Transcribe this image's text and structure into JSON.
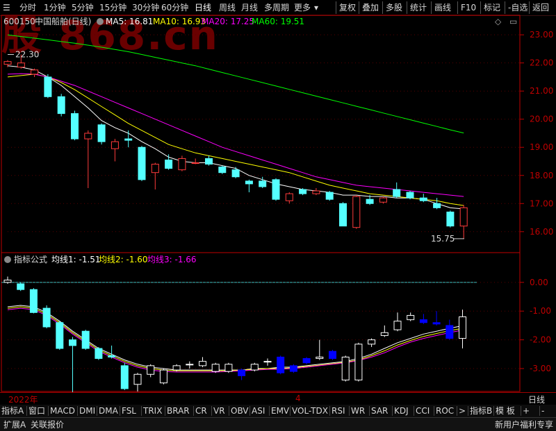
{
  "toolbar": {
    "left_items": [
      "分时",
      "1分钟",
      "5分钟",
      "15分钟",
      "30分钟",
      "60分钟",
      "日线",
      "周线",
      "月线",
      "多周期",
      "更多"
    ],
    "active_item": "日线",
    "right_items": [
      "复权",
      "叠加",
      "多股",
      "统计",
      "画线",
      "F10",
      "标记",
      "-自选",
      "返回"
    ]
  },
  "watermark": "股 868.cn",
  "stock": {
    "code": "600150",
    "name": "中国船舶",
    "period": "(日线)"
  },
  "ma": [
    {
      "label": "MA5: 16.81",
      "color": "#ffffff"
    },
    {
      "label": "MA10: 16.93",
      "color": "#ffff00"
    },
    {
      "label": "MA20: 17.25",
      "color": "#ff00ff"
    },
    {
      "label": "MA60: 19.51",
      "color": "#00ff00"
    }
  ],
  "price_axis": [
    "23.00",
    "22.00",
    "21.00",
    "20.00",
    "19.00",
    "18.00",
    "17.00",
    "16.00"
  ],
  "max_label": "22.30",
  "min_label": "15.75",
  "indicator": {
    "title": "指标公式",
    "lines": [
      {
        "label": "均线1: -1.51",
        "color": "#ffffff"
      },
      {
        "label": "均线2: -1.60",
        "color": "#ffff00"
      },
      {
        "label": "均线3: -1.66",
        "color": "#ff00ff"
      }
    ],
    "axis": [
      "0.00",
      "-1.00",
      "-2.00",
      "-3.00"
    ]
  },
  "time_axis": {
    "start": "2022年",
    "mid": "4",
    "period": "日线"
  },
  "tabs": [
    "指标A",
    "窗口",
    "MACD",
    "DMI",
    "DMA",
    "FSL",
    "TRIX",
    "BRAR",
    "CR",
    "VR",
    "OBV",
    "ASI",
    "EMV",
    "VOL-TDX",
    "RSI",
    "WR",
    "SAR",
    "KDJ",
    "CCI",
    "ROC",
    ">",
    "指标B",
    "模 板",
    "+",
    "-"
  ],
  "status": {
    "left": [
      "扩展A",
      "关联报价"
    ],
    "right": "新用户福利专享"
  },
  "chart_data": [
    {
      "type": "candlestick",
      "title": "600150 中国船舶(日线)",
      "ylim": [
        15.6,
        23.3
      ],
      "candles": [
        [
          21.95,
          22.05,
          21.85,
          22.1
        ],
        [
          21.85,
          22.0,
          21.8,
          22.3
        ],
        [
          21.6,
          21.75,
          21.5,
          21.8
        ],
        [
          21.5,
          20.8,
          20.75,
          21.6
        ],
        [
          20.8,
          20.2,
          20.1,
          20.9
        ],
        [
          20.2,
          19.3,
          19.25,
          20.3
        ],
        [
          19.3,
          19.5,
          17.55,
          19.6
        ],
        [
          19.8,
          19.2,
          19.1,
          19.85
        ],
        [
          18.95,
          19.2,
          18.5,
          19.3
        ],
        [
          19.3,
          19.25,
          19.0,
          19.6
        ],
        [
          19.0,
          17.85,
          17.8,
          19.05
        ],
        [
          18.1,
          18.4,
          17.5,
          18.45
        ],
        [
          18.55,
          18.25,
          18.2,
          18.75
        ],
        [
          18.2,
          18.6,
          18.15,
          18.7
        ],
        [
          18.45,
          18.45,
          18.4,
          18.6
        ],
        [
          18.6,
          18.4,
          18.35,
          18.7
        ],
        [
          18.3,
          18.1,
          18.05,
          18.35
        ],
        [
          18.2,
          17.95,
          17.9,
          18.3
        ],
        [
          17.8,
          17.7,
          17.4,
          17.85
        ],
        [
          17.8,
          17.6,
          17.55,
          17.95
        ],
        [
          17.85,
          17.15,
          17.1,
          17.9
        ],
        [
          17.1,
          17.35,
          17.0,
          17.4
        ],
        [
          17.5,
          17.35,
          17.3,
          17.55
        ],
        [
          17.35,
          17.45,
          17.3,
          17.55
        ],
        [
          17.4,
          17.15,
          17.1,
          17.45
        ],
        [
          17.0,
          16.2,
          16.2,
          17.05
        ],
        [
          16.15,
          17.25,
          16.1,
          17.3
        ],
        [
          17.15,
          17.0,
          16.95,
          17.3
        ],
        [
          17.05,
          17.2,
          17.0,
          17.25
        ],
        [
          17.5,
          17.25,
          17.2,
          17.75
        ],
        [
          17.4,
          17.2,
          17.15,
          17.45
        ],
        [
          17.2,
          17.1,
          17.05,
          17.35
        ],
        [
          17.0,
          16.85,
          16.8,
          17.2
        ],
        [
          16.7,
          16.2,
          16.15,
          16.75
        ],
        [
          16.2,
          16.85,
          15.75,
          16.95
        ]
      ],
      "series": [
        {
          "name": "MA5",
          "values": [
            21.9,
            21.85,
            21.75,
            21.5,
            21.2,
            20.8,
            20.4,
            19.95,
            19.7,
            19.5,
            19.2,
            18.95,
            18.65,
            18.5,
            18.45,
            18.45,
            18.35,
            18.25,
            18.0,
            17.85,
            17.7,
            17.6,
            17.5,
            17.45,
            17.4,
            17.3,
            17.3,
            17.25,
            17.25,
            17.2,
            17.2,
            17.15,
            17.0,
            16.85,
            16.81
          ]
        },
        {
          "name": "MA10",
          "values": [
            21.5,
            21.55,
            21.6,
            21.5,
            21.3,
            21.05,
            20.75,
            20.45,
            20.15,
            19.85,
            19.6,
            19.35,
            19.1,
            18.95,
            18.8,
            18.7,
            18.6,
            18.5,
            18.4,
            18.3,
            18.2,
            18.1,
            17.95,
            17.8,
            17.65,
            17.55,
            17.45,
            17.35,
            17.3,
            17.25,
            17.2,
            17.15,
            17.1,
            17.0,
            16.93
          ]
        },
        {
          "name": "MA20",
          "values": [
            21.6,
            21.62,
            21.6,
            21.5,
            21.35,
            21.2,
            21.0,
            20.8,
            20.6,
            20.4,
            20.2,
            20.0,
            19.8,
            19.6,
            19.4,
            19.2,
            19.0,
            18.85,
            18.7,
            18.55,
            18.4,
            18.25,
            18.1,
            17.95,
            17.85,
            17.75,
            17.65,
            17.6,
            17.55,
            17.5,
            17.45,
            17.4,
            17.35,
            17.3,
            17.25
          ]
        },
        {
          "name": "MA60",
          "values": [
            23.0,
            22.94,
            22.88,
            22.82,
            22.76,
            22.7,
            22.63,
            22.56,
            22.48,
            22.4,
            22.3,
            22.2,
            22.1,
            22.0,
            21.9,
            21.78,
            21.66,
            21.54,
            21.42,
            21.3,
            21.18,
            21.06,
            20.94,
            20.82,
            20.7,
            20.58,
            20.46,
            20.34,
            20.22,
            20.1,
            19.98,
            19.86,
            19.74,
            19.62,
            19.51
          ]
        }
      ]
    },
    {
      "type": "candlestick",
      "title": "指标公式",
      "ylim": [
        -3.7,
        0.6
      ],
      "candles": [
        [
          0.0,
          0.08,
          -0.05,
          0.2
        ],
        [
          -0.05,
          -0.25,
          -0.3,
          0.0
        ],
        [
          -0.25,
          -1.05,
          -1.08,
          -0.2
        ],
        [
          -0.9,
          -1.55,
          -1.6,
          -0.8
        ],
        [
          -1.4,
          -2.3,
          -2.35,
          -1.35
        ],
        [
          -2.0,
          -2.2,
          -3.9,
          -1.9
        ],
        [
          -1.7,
          -2.3,
          -2.35,
          -1.65
        ],
        [
          -2.3,
          -2.65,
          -2.7,
          -2.25
        ],
        [
          -2.55,
          -2.6,
          -2.65,
          -2.2
        ],
        [
          -2.9,
          -3.7,
          -3.75,
          -2.8
        ],
        [
          -3.55,
          -3.2,
          -3.8,
          -3.15
        ],
        [
          -3.2,
          -2.9,
          -3.3,
          -2.85
        ],
        [
          -3.5,
          -3.05,
          -3.55,
          -3.0
        ],
        [
          -3.05,
          -2.9,
          -3.1,
          -2.85
        ],
        [
          -2.85,
          -2.85,
          -3.0,
          -2.75
        ],
        [
          -2.9,
          -2.75,
          -2.95,
          -2.6
        ],
        [
          -3.1,
          -2.85,
          -3.15,
          -2.8
        ],
        [
          -3.1,
          -2.85,
          -3.15,
          -2.8
        ],
        [
          -3.05,
          -3.25,
          -3.4,
          -3.0
        ],
        [
          -3.05,
          -2.85,
          -3.1,
          -2.8
        ],
        [
          -2.75,
          -2.75,
          -2.9,
          -2.65
        ],
        [
          -2.6,
          -3.15,
          -3.2,
          -2.55
        ],
        [
          -2.9,
          -3.1,
          -3.15,
          -2.85
        ],
        [
          -2.65,
          -2.8,
          -2.85,
          -2.6
        ],
        [
          -2.65,
          -2.6,
          -2.7,
          -2.0
        ],
        [
          -2.4,
          -2.65,
          -2.7,
          -2.35
        ],
        [
          -3.4,
          -2.6,
          -3.45,
          -2.55
        ],
        [
          -3.4,
          -2.15,
          -3.45,
          -2.1
        ],
        [
          -2.15,
          -2.0,
          -2.25,
          -1.95
        ],
        [
          -1.85,
          -1.75,
          -1.9,
          -1.5
        ],
        [
          -1.65,
          -1.35,
          -1.7,
          -1.05
        ],
        [
          -1.3,
          -1.15,
          -1.35,
          -1.05
        ],
        [
          -1.3,
          -1.4,
          -1.45,
          -1.1
        ],
        [
          -1.4,
          -1.45,
          -1.5,
          -1.0
        ],
        [
          -1.5,
          -1.95,
          -2.0,
          -1.3
        ],
        [
          -1.95,
          -1.2,
          -2.3,
          -0.95
        ]
      ],
      "series": [
        {
          "name": "均线1",
          "values": [
            -0.85,
            -0.8,
            -0.85,
            -1.05,
            -1.35,
            -1.7,
            -2.0,
            -2.3,
            -2.5,
            -2.7,
            -2.85,
            -2.95,
            -3.0,
            -3.05,
            -3.05,
            -3.05,
            -3.05,
            -3.05,
            -3.05,
            -3.0,
            -3.0,
            -2.95,
            -2.95,
            -2.9,
            -2.85,
            -2.8,
            -2.75,
            -2.65,
            -2.5,
            -2.3,
            -2.1,
            -1.95,
            -1.8,
            -1.7,
            -1.6,
            -1.51
          ]
        },
        {
          "name": "均线2",
          "values": [
            -0.9,
            -0.85,
            -0.9,
            -1.1,
            -1.4,
            -1.75,
            -2.05,
            -2.35,
            -2.55,
            -2.75,
            -2.9,
            -3.0,
            -3.05,
            -3.08,
            -3.08,
            -3.08,
            -3.08,
            -3.08,
            -3.05,
            -3.03,
            -3.0,
            -3.0,
            -2.97,
            -2.93,
            -2.88,
            -2.83,
            -2.78,
            -2.7,
            -2.55,
            -2.38,
            -2.18,
            -2.02,
            -1.88,
            -1.78,
            -1.68,
            -1.6
          ]
        },
        {
          "name": "均线3",
          "values": [
            -0.95,
            -0.9,
            -0.95,
            -1.15,
            -1.45,
            -1.8,
            -2.1,
            -2.4,
            -2.6,
            -2.8,
            -2.95,
            -3.05,
            -3.1,
            -3.12,
            -3.12,
            -3.12,
            -3.12,
            -3.1,
            -3.08,
            -3.05,
            -3.03,
            -3.02,
            -3.0,
            -2.95,
            -2.9,
            -2.85,
            -2.8,
            -2.72,
            -2.6,
            -2.45,
            -2.25,
            -2.08,
            -1.95,
            -1.85,
            -1.75,
            -1.66
          ]
        }
      ]
    }
  ]
}
